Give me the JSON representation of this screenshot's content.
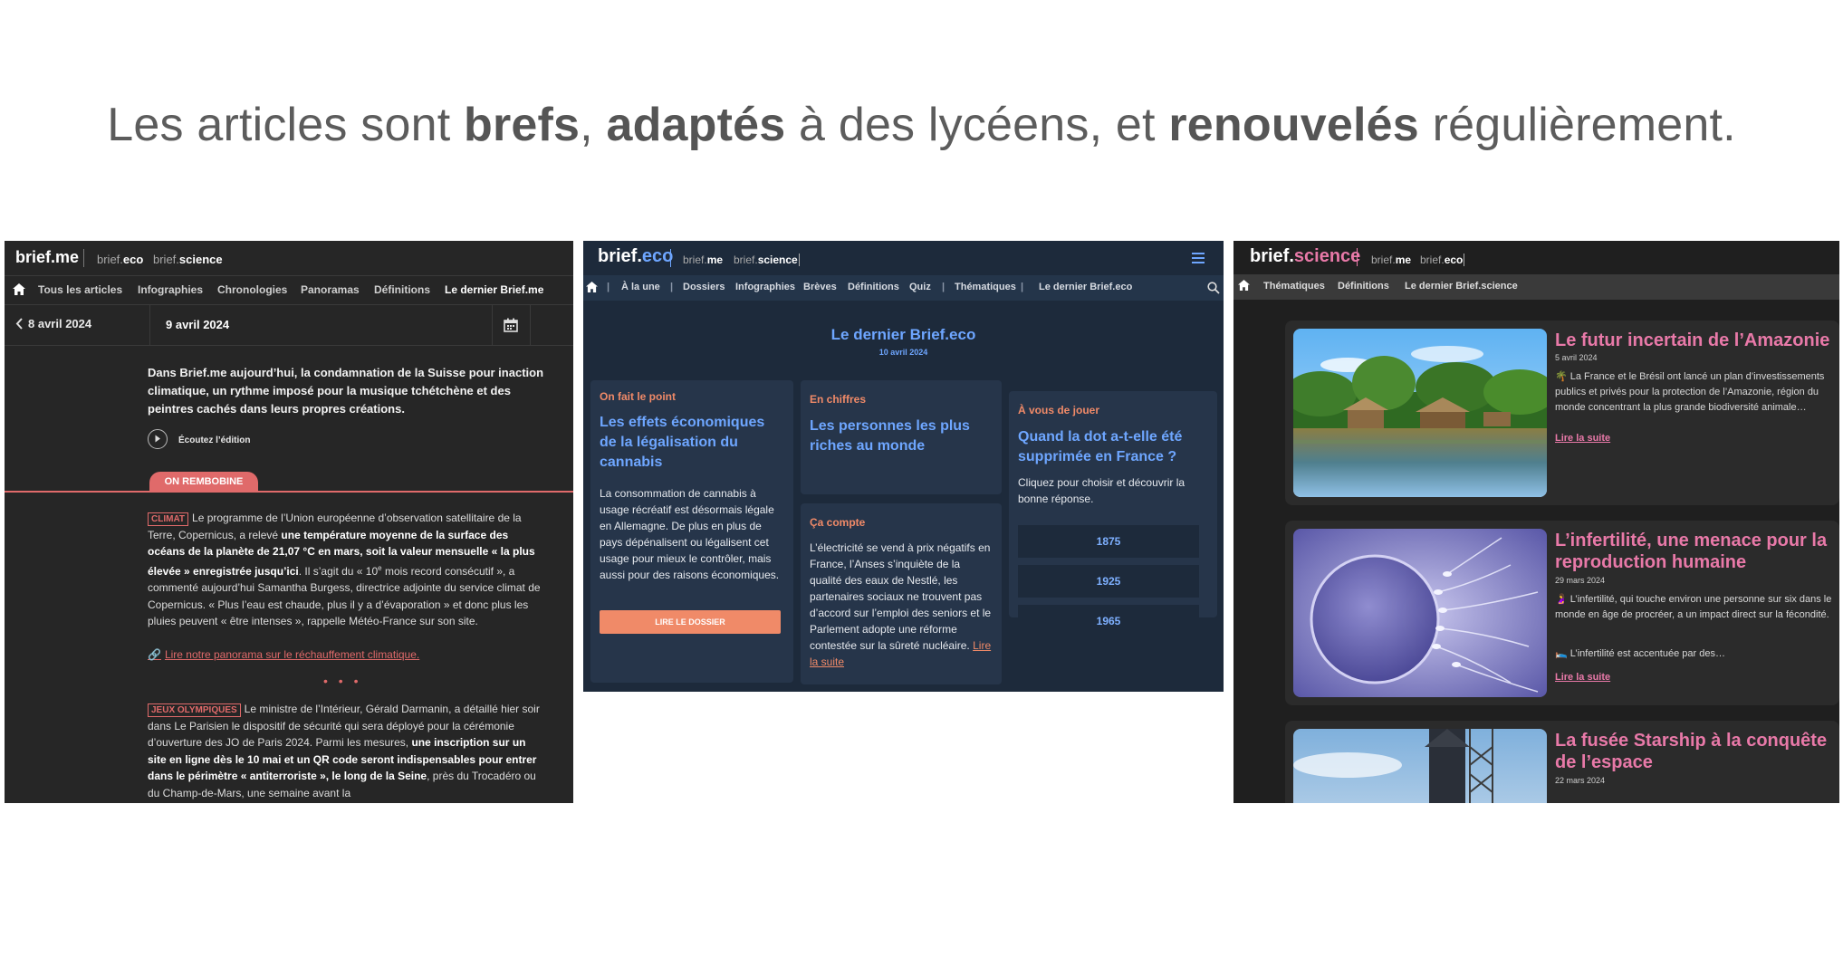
{
  "headline": {
    "p1": "Les articles sont ",
    "b1": "brefs",
    "p2": ", ",
    "b2": "adaptés",
    "p3": " à des lycéens, et ",
    "b3": "renouvelés",
    "p4": " régulièrement."
  },
  "briefme": {
    "logo": "brief.me",
    "links": [
      {
        "pre": "brief.",
        "bold": "eco"
      },
      {
        "pre": "brief.",
        "bold": "science"
      }
    ],
    "nav": [
      "Tous les articles",
      "Infographies",
      "Chronologies",
      "Panoramas",
      "Définitions",
      "Le dernier Brief.me"
    ],
    "prev_date": "8 avril 2024",
    "date": "9 avril 2024",
    "intro": "Dans Brief.me aujourd’hui, la condamnation de la Suisse pour inaction climatique, un rythme imposé pour la musique tchétchène et des peintres cachés dans leurs propres créations.",
    "listen": "Écoutez l’édition",
    "rubric": "ON REMBOBINE",
    "article1": {
      "category": "CLIMAT",
      "t1": "Le programme de l’Union européenne d’observation satellitaire de la Terre, Copernicus, a relevé ",
      "b1": "une température moyenne de la surface des océans de la planète de 21,07 °C en mars, soit la valeur mensuelle « la plus élevée » enregistrée jusqu’ici",
      "t2": ". Il s’agit du « 10",
      "sup": "e",
      "t3": " mois record consécutif », a commenté aujourd’hui Samantha Burgess, directrice adjointe du service climat de Copernicus. « Plus l’eau est chaude, plus il y a d’évaporation » et donc plus les pluies peuvent « être intenses », rappelle Météo-France sur son site."
    },
    "link": "Lire notre panorama sur le réchauffement climatique.",
    "separator": "• • •",
    "article2": {
      "category": "JEUX OLYMPIQUES",
      "t1": "Le ministre de l’Intérieur, Gérald Darmanin, a détaillé hier soir dans Le Parisien le dispositif de sécurité qui sera déployé pour la cérémonie d’ouverture des JO de Paris 2024. Parmi les mesures, ",
      "b1": "une inscription sur un site en ligne dès le 10 mai et un QR code seront indispensables pour entrer dans le périmètre « antiterroriste », le long de la Seine",
      "t2": ", près du Trocadéro ou du Champ-de-Mars, une semaine avant la"
    }
  },
  "briefeco": {
    "logo_pre": "brief.",
    "logo_accent": "eco",
    "links": [
      {
        "pre": "brief.",
        "bold": "me"
      },
      {
        "pre": "brief.",
        "bold": "science"
      }
    ],
    "nav": [
      "À la une",
      "Dossiers",
      "Infographies",
      "Brèves",
      "Définitions",
      "Quiz",
      "Thématiques",
      "Le dernier Brief.eco"
    ],
    "nav_sep": "|",
    "title": "Le dernier Brief.eco",
    "date": "10 avril 2024",
    "card1": {
      "tag": "On fait le point",
      "title": "Les effets économiques de la légalisation du cannabis",
      "text": "La consommation de cannabis à usage récréatif est désormais légale en Allemagne. De plus en plus de pays dépénalisent ou légalisent cet usage pour mieux le contrôler, mais aussi pour des raisons économiques.",
      "button": "LIRE LE DOSSIER"
    },
    "card2": {
      "tag": "En chiffres",
      "title": "Les personnes les plus riches au monde"
    },
    "card3": {
      "tag": "Ça compte",
      "text": "L’électricité se vend à prix négatifs en France, l’Anses s’inquiète de la qualité des eaux de Nestlé, les partenaires sociaux ne trouvent pas d’accord sur l’emploi des seniors et le Parlement adopte une réforme contestée sur la sûreté nucléaire. ",
      "link1": "Lire",
      "link2": "la suite"
    },
    "card4": {
      "tag": "À vous de jouer",
      "title": "Quand la dot a-t-elle été supprimée en France ?",
      "text": "Cliquez pour choisir et découvrir la bonne réponse.",
      "options": [
        "1875",
        "1925",
        "1965"
      ]
    }
  },
  "briefscience": {
    "logo_pre": "brief.",
    "logo_accent": "science",
    "links": [
      {
        "pre": "brief.",
        "bold": "me"
      },
      {
        "pre": "brief.",
        "bold": "eco"
      }
    ],
    "nav": [
      "Thématiques",
      "Définitions",
      "Le dernier Brief.science"
    ],
    "articles": [
      {
        "title": "Le futur incertain de l’Amazonie",
        "date": "5 avril 2024",
        "text": "🌴 La France et le Brésil ont lancé un plan d’investissements publics et privés pour la protection de l’Amazonie, région du monde concentrant la plus grande biodiversité animale…",
        "text2": "",
        "more": "Lire la suite"
      },
      {
        "title": "L’infertilité, une menace pour la reproduction humaine",
        "date": "29 mars 2024",
        "text": "🤰 L’infertilité, qui touche environ une personne sur six dans le monde en âge de procréer, a un impact direct sur la fécondité.",
        "text2": "🛌 L’infertilité est accentuée par des…",
        "more": "Lire la suite"
      },
      {
        "title": "La fusée Starship à la conquête de l’espace",
        "date": "22 mars 2024",
        "text": "",
        "text2": "",
        "more": ""
      }
    ]
  }
}
